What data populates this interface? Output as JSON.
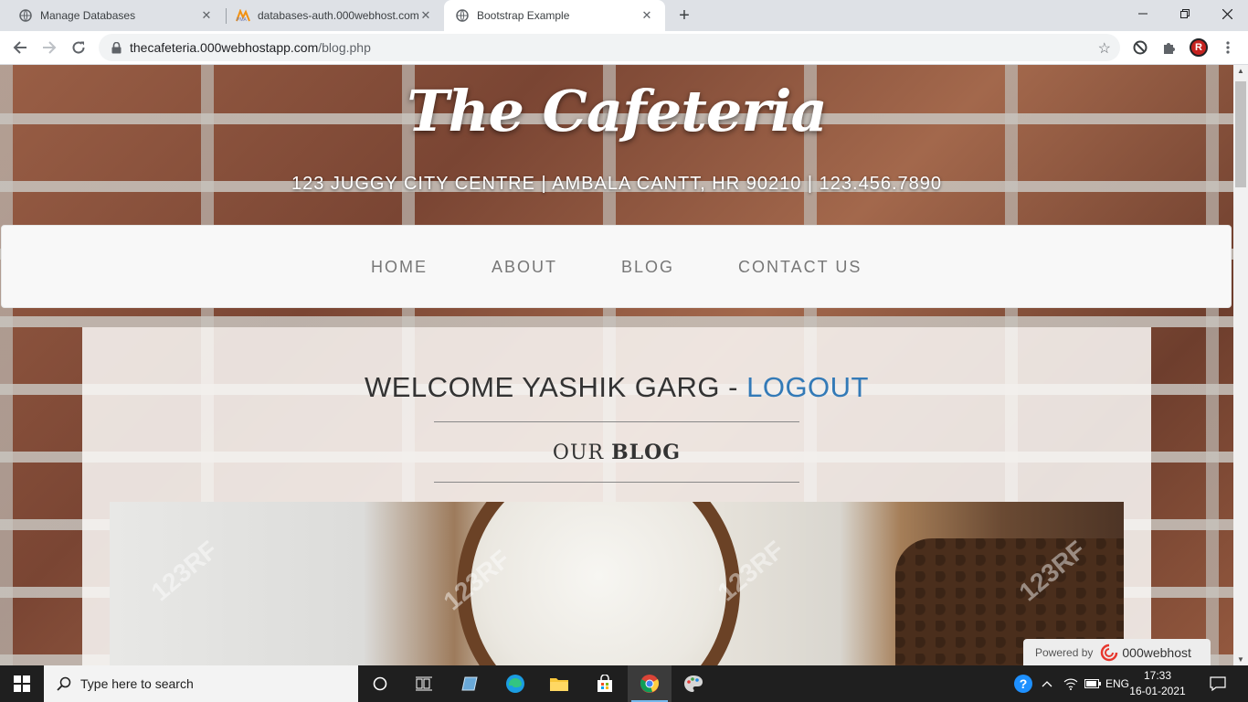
{
  "browser": {
    "tabs": [
      {
        "title": "Manage Databases",
        "icon": "globe-icon",
        "active": false
      },
      {
        "title": "databases-auth.000webhost.com",
        "icon": "phpmyadmin-icon",
        "active": false
      },
      {
        "title": "Bootstrap Example",
        "icon": "globe-icon",
        "active": true
      }
    ],
    "new_tab": "+",
    "url_host": "thecafeteria.000webhostapp.com",
    "url_path": "/blog.php",
    "profile_initial": "R"
  },
  "page": {
    "brand": "The Cafeteria",
    "address": "123 JUGGY CITY CENTRE | AMBALA CANTT, HR 90210 | 123.456.7890",
    "nav": [
      "HOME",
      "ABOUT",
      "BLOG",
      "CONTACT US"
    ],
    "welcome_text": "WELCOME YASHIK GARG - ",
    "logout_label": "LOGOUT",
    "section_title_prefix": "OUR ",
    "section_title_bold": "BLOG",
    "watermark": "123RF",
    "powered_label": "Powered by",
    "powered_name": "000webhost"
  },
  "colors": {
    "link": "#337ab7",
    "navbar_bg": "#f8f8f8",
    "nav_text": "#777777"
  },
  "taskbar": {
    "search_placeholder": "Type here to search",
    "language": "ENG",
    "time": "17:33",
    "date": "16-01-2021"
  }
}
